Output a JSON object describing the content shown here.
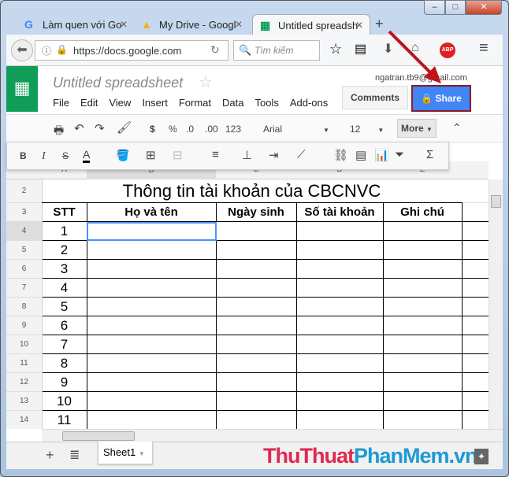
{
  "browser": {
    "tabs": [
      {
        "label": "Làm quen với Go",
        "icon": "google-icon"
      },
      {
        "label": "My Drive - Googl",
        "icon": "drive-icon"
      },
      {
        "label": "Untitled spreadsh",
        "icon": "sheets-icon"
      }
    ],
    "new_tab": "+",
    "url": "https://docs.google.com",
    "search_placeholder": "Tìm kiếm",
    "abp": "ABP"
  },
  "doc": {
    "title": "Untitled spreadsheet",
    "account": "ngatran.tb9@gmail.com",
    "menu": [
      "File",
      "Edit",
      "View",
      "Insert",
      "Format",
      "Data",
      "Tools",
      "Add-ons"
    ],
    "comments": "Comments",
    "share": "Share",
    "share_color": "#4285f4"
  },
  "toolbar": {
    "currency": "$",
    "percent": "%",
    "dec_dec": ".0",
    "dec_inc": ".00",
    "format": "123",
    "font": "Arial",
    "size": "12",
    "more": "More"
  },
  "more_toolbar": {
    "bold": "B",
    "italic": "I",
    "strike": "S",
    "text_color": "A",
    "sum": "Σ"
  },
  "grid": {
    "columns": [
      "A",
      "B",
      "C",
      "D",
      "E"
    ],
    "title": "Thông tin tài khoản của CBCNVC",
    "headers": [
      "STT",
      "Họ và tên",
      "Ngày sinh",
      "Số tài khoản",
      "Ghi chú"
    ],
    "rows": [
      {
        "n": "2"
      },
      {
        "n": "3"
      },
      {
        "n": "4",
        "v": "1"
      },
      {
        "n": "5",
        "v": "2"
      },
      {
        "n": "6",
        "v": "3"
      },
      {
        "n": "7",
        "v": "4"
      },
      {
        "n": "8",
        "v": "5"
      },
      {
        "n": "9",
        "v": "6"
      },
      {
        "n": "10",
        "v": "7"
      },
      {
        "n": "11",
        "v": "8"
      },
      {
        "n": "12",
        "v": "9"
      },
      {
        "n": "13",
        "v": "10"
      },
      {
        "n": "14",
        "v": "11"
      }
    ]
  },
  "bottom": {
    "sheet_tab": "Sheet1",
    "add": "+",
    "watermark": {
      "red": "ThuThuat",
      "blue": "PhanMem.vn"
    }
  }
}
